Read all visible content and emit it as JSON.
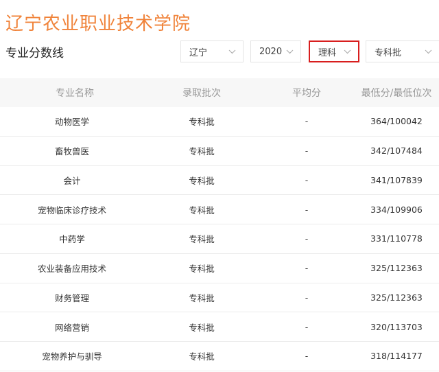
{
  "header": {
    "school_name": "辽宁农业职业技术学院",
    "section_title": "专业分数线"
  },
  "filters": {
    "province": "辽宁",
    "year": "2020",
    "subject": "理科",
    "batch": "专科批"
  },
  "colors": {
    "accent": "#f0833a",
    "highlight_border": "#d81e1e"
  },
  "table": {
    "columns": [
      "专业名称",
      "录取批次",
      "平均分",
      "最低分/最低位次"
    ],
    "rows": [
      {
        "major": "动物医学",
        "batch": "专科批",
        "avg": "-",
        "min": "364/100042"
      },
      {
        "major": "畜牧兽医",
        "batch": "专科批",
        "avg": "-",
        "min": "342/107484"
      },
      {
        "major": "会计",
        "batch": "专科批",
        "avg": "-",
        "min": "341/107839"
      },
      {
        "major": "宠物临床诊疗技术",
        "batch": "专科批",
        "avg": "-",
        "min": "334/109906"
      },
      {
        "major": "中药学",
        "batch": "专科批",
        "avg": "-",
        "min": "331/110778"
      },
      {
        "major": "农业装备应用技术",
        "batch": "专科批",
        "avg": "-",
        "min": "325/112363"
      },
      {
        "major": "财务管理",
        "batch": "专科批",
        "avg": "-",
        "min": "325/112363"
      },
      {
        "major": "网络营销",
        "batch": "专科批",
        "avg": "-",
        "min": "320/113703"
      },
      {
        "major": "宠物养护与驯导",
        "batch": "专科批",
        "avg": "-",
        "min": "318/114177"
      }
    ]
  }
}
